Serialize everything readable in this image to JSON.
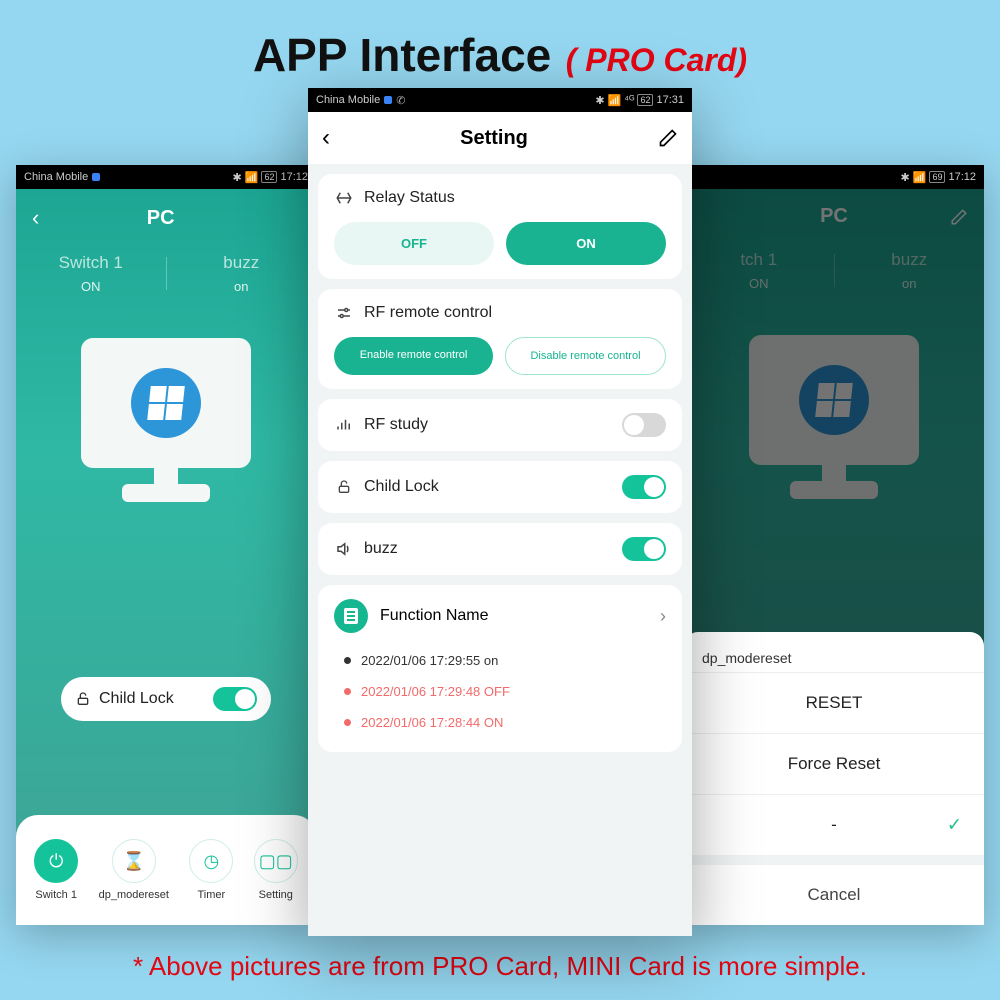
{
  "header": {
    "title": "APP Interface",
    "subtitle": "( PRO Card)"
  },
  "footnote": "* Above pictures are from PRO Card, MINI Card is more simple.",
  "status": {
    "carrier": "China Mobile",
    "time_left": "17:12",
    "time_center": "17:31",
    "time_right": "17:12",
    "battery_left": "62",
    "battery_center": "62",
    "battery_right": "69"
  },
  "left": {
    "title": "PC",
    "tabs": [
      {
        "label": "Switch 1",
        "status": "ON"
      },
      {
        "label": "buzz",
        "status": "on"
      }
    ],
    "child_lock_label": "Child Lock",
    "dock": [
      {
        "label": "Switch 1"
      },
      {
        "label": "dp_modereset"
      },
      {
        "label": "Timer"
      },
      {
        "label": "Setting"
      }
    ]
  },
  "right": {
    "title": "PC",
    "tabs": [
      {
        "label": "tch 1",
        "status": "ON"
      },
      {
        "label": "buzz",
        "status": "on"
      }
    ],
    "sheet": {
      "title": "dp_modereset",
      "rows": [
        "RESET",
        "Force Reset",
        "-"
      ],
      "cancel": "Cancel"
    }
  },
  "center": {
    "title": "Setting",
    "relay": {
      "title": "Relay Status",
      "off": "OFF",
      "on": "ON"
    },
    "rf_ctrl": {
      "title": "RF remote control",
      "enable": "Enable remote control",
      "disable": "Disable remote control"
    },
    "rf_study": {
      "title": "RF study",
      "on": false
    },
    "child_lock": {
      "title": "Child Lock",
      "on": true
    },
    "buzz": {
      "title": "buzz",
      "on": true
    },
    "fn": {
      "title": "Function Name",
      "logs": [
        {
          "text": "2022/01/06 17:29:55 on",
          "kind": "on"
        },
        {
          "text": "2022/01/06 17:29:48 OFF",
          "kind": "red"
        },
        {
          "text": "2022/01/06 17:28:44 ON",
          "kind": "red"
        }
      ]
    }
  }
}
